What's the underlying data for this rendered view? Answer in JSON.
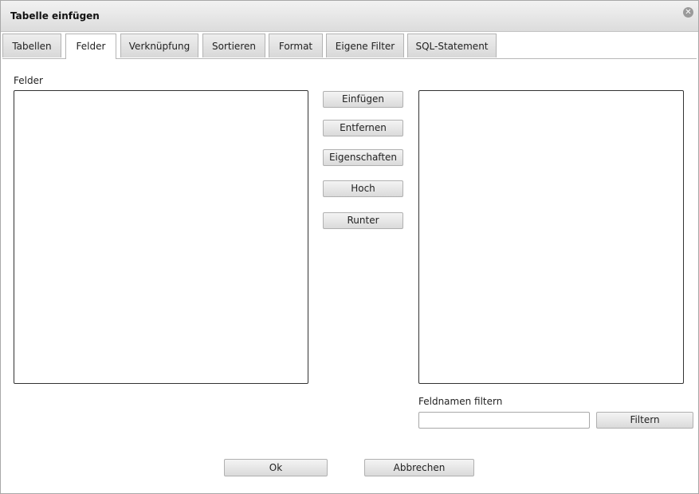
{
  "window": {
    "title": "Tabelle einfügen",
    "close_icon": "close-icon"
  },
  "tabs": [
    {
      "label": "Tabellen"
    },
    {
      "label": "Felder",
      "active": true
    },
    {
      "label": "Verknüpfung"
    },
    {
      "label": "Sortieren"
    },
    {
      "label": "Format"
    },
    {
      "label": "Eigene Filter"
    },
    {
      "label": "SQL-Statement"
    }
  ],
  "felder": {
    "label": "Felder",
    "buttons": {
      "einfuegen": "Einfügen",
      "entfernen": "Entfernen",
      "eigenschaften": "Eigenschaften",
      "hoch": "Hoch",
      "runter": "Runter"
    },
    "filter": {
      "label": "Feldnamen filtern",
      "value": "",
      "button": "Filtern"
    }
  },
  "footer": {
    "ok": "Ok",
    "cancel": "Abbrechen"
  }
}
